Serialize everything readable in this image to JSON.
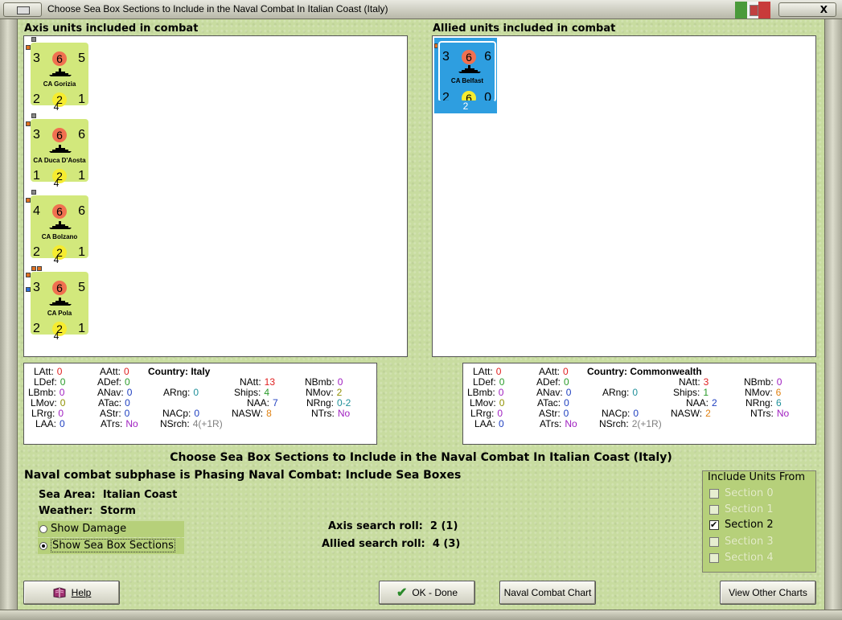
{
  "window": {
    "title": "Choose Sea Box Sections to Include in the Naval Combat In Italian Coast (Italy)",
    "close_label": "X"
  },
  "axis": {
    "heading": "Axis units included in combat",
    "units": [
      {
        "name": "CA Gorizia",
        "tl": "3",
        "tc": "6",
        "tr": "5",
        "bl": "2",
        "bc": "2",
        "br": "1",
        "below": "4"
      },
      {
        "name": "CA Duca D'Aosta",
        "tl": "3",
        "tc": "6",
        "tr": "6",
        "bl": "1",
        "bc": "2",
        "br": "1",
        "below": "4"
      },
      {
        "name": "CA Bolzano",
        "tl": "4",
        "tc": "6",
        "tr": "6",
        "bl": "2",
        "bc": "2",
        "br": "1",
        "below": "4"
      },
      {
        "name": "CA Pola",
        "tl": "3",
        "tc": "6",
        "tr": "5",
        "bl": "2",
        "bc": "2",
        "br": "1",
        "below": "4"
      }
    ],
    "stats": {
      "LAtt": "0",
      "LDef": "0",
      "LBmb": "0",
      "LMov": "0",
      "LRrg": "0",
      "LAA": "0",
      "AAtt": "0",
      "ADef": "0",
      "ANav": "0",
      "ATac": "0",
      "AStr": "0",
      "ATrs": "No",
      "country_label": "Country:",
      "country": "Italy",
      "ARng": "0",
      "NACp": "0",
      "NSrch": "4(+1R)",
      "NAtt": "13",
      "Ships": "4",
      "NAA": "7",
      "NASW": "8",
      "NBmb": "0",
      "NMov": "2",
      "NRng": "0-2",
      "NTrs": "No"
    }
  },
  "allied": {
    "heading": "Allied units included in combat",
    "units": [
      {
        "name": "CA Belfast",
        "tl": "3",
        "tc": "6",
        "tr": "6",
        "bl": "2",
        "bc": "6",
        "br": "0",
        "below": "2"
      }
    ],
    "stats": {
      "LAtt": "0",
      "LDef": "0",
      "LBmb": "0",
      "LMov": "0",
      "LRrg": "0",
      "LAA": "0",
      "AAtt": "0",
      "ADef": "0",
      "ANav": "0",
      "ATac": "0",
      "AStr": "0",
      "ATrs": "No",
      "country_label": "Country:",
      "country": "Commonwealth",
      "ARng": "0",
      "NACp": "0",
      "NSrch": "2(+1R)",
      "NAtt": "3",
      "Ships": "1",
      "NAA": "2",
      "NASW": "2",
      "NBmb": "0",
      "NMov": "6",
      "NRng": "6",
      "NTrs": "No"
    }
  },
  "labels": {
    "LAtt": "LAtt:",
    "LDef": "LDef:",
    "LBmb": "LBmb:",
    "LMov": "LMov:",
    "LRrg": "LRrg:",
    "LAA": "LAA:",
    "AAtt": "AAtt:",
    "ADef": "ADef:",
    "ANav": "ANav:",
    "ATac": "ATac:",
    "AStr": "AStr:",
    "ATrs": "ATrs:",
    "ARng": "ARng:",
    "NACp": "NACp:",
    "NSrch": "NSrch:",
    "NAtt": "NAtt:",
    "Ships": "Ships:",
    "NAA": "NAA:",
    "NASW": "NASW:",
    "NBmb": "NBmb:",
    "NMov": "NMov:",
    "NRng": "NRng:",
    "NTrs": "NTrs:"
  },
  "main_heading": "Choose Sea Box Sections to Include in the Naval Combat In Italian Coast (Italy)",
  "subphase": "Naval combat subphase is Phasing Naval Combat: Include Sea Boxes",
  "sea_area": {
    "label": "Sea Area:",
    "value": "Italian Coast"
  },
  "weather": {
    "label": "Weather:",
    "value": "Storm"
  },
  "options": {
    "show_damage": "Show Damage",
    "show_sea_box_sections": "Show Sea Box Sections"
  },
  "search": {
    "axis_label": "Axis search roll:",
    "axis_value": "2 (1)",
    "allied_label": "Allied search roll:",
    "allied_value": "4 (3)"
  },
  "include": {
    "title": "Include Units From",
    "sections": [
      {
        "label": "Section 0",
        "checked": false,
        "enabled": false
      },
      {
        "label": "Section 1",
        "checked": false,
        "enabled": false
      },
      {
        "label": "Section 2",
        "checked": true,
        "enabled": true
      },
      {
        "label": "Section 3",
        "checked": false,
        "enabled": false
      },
      {
        "label": "Section 4",
        "checked": false,
        "enabled": false
      }
    ]
  },
  "buttons": {
    "help": "Help",
    "ok": "OK - Done",
    "naval_chart": "Naval Combat Chart",
    "other_charts": "View Other Charts"
  },
  "colors": {
    "background": "#c8dca0",
    "axis_counter": "#d2e87c",
    "allied_counter": "#2e9ee0",
    "attack_circle": "#f07050",
    "defense_circle": "#f6ec30"
  }
}
